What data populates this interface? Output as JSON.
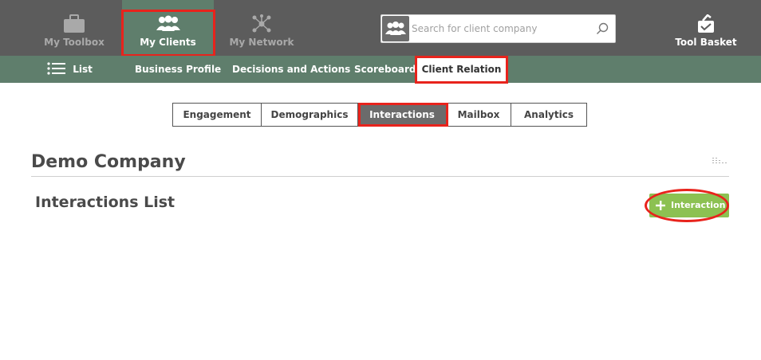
{
  "topnav": {
    "toolbox_label": "My Toolbox",
    "clients_label": "My Clients",
    "network_label": "My Network",
    "basket_label": "Tool Basket"
  },
  "search": {
    "placeholder": "Search for client company"
  },
  "subnav": {
    "list_label": "List",
    "business_profile": "Business Profile",
    "decisions_actions": "Decisions and Actions",
    "scoreboard": "Scoreboard",
    "client_relation": "Client Relation"
  },
  "tabs": [
    {
      "label": "Engagement"
    },
    {
      "label": "Demographics"
    },
    {
      "label": "Interactions"
    },
    {
      "label": "Mailbox"
    },
    {
      "label": "Analytics"
    }
  ],
  "content": {
    "company_name": "Demo Company",
    "section_title": "Interactions List",
    "add_button_label": "Interaction"
  },
  "colors": {
    "topbar": "#5c5c5c",
    "accent_green": "#5f7e6c",
    "button_green": "#8cc152",
    "highlight_red": "#e8231c"
  }
}
